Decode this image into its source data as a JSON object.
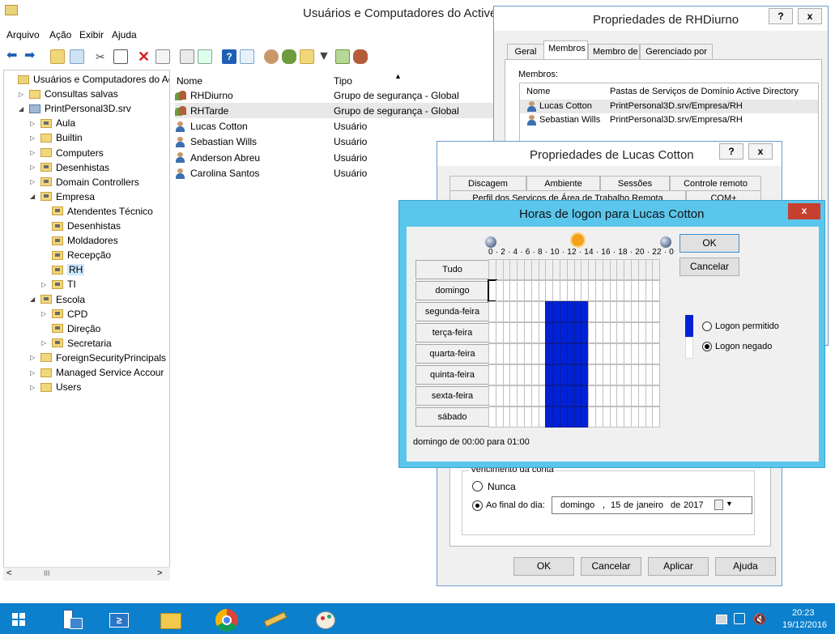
{
  "main": {
    "title": "Usuários e Computadores do Active",
    "menu": [
      "Arquivo",
      "Ação",
      "Exibir",
      "Ajuda"
    ],
    "tree": [
      {
        "label": "Usuários e Computadores do Ac",
        "indent": 0,
        "arrow": "",
        "icon": "root"
      },
      {
        "label": "Consultas salvas",
        "indent": 1,
        "arrow": "▷",
        "icon": "folder"
      },
      {
        "label": "PrintPersonal3D.srv",
        "indent": 1,
        "arrow": "◢",
        "icon": "domain"
      },
      {
        "label": "Aula",
        "indent": 2,
        "arrow": "▷",
        "icon": "ou"
      },
      {
        "label": "Builtin",
        "indent": 2,
        "arrow": "▷",
        "icon": "folder"
      },
      {
        "label": "Computers",
        "indent": 2,
        "arrow": "▷",
        "icon": "folder"
      },
      {
        "label": "Desenhistas",
        "indent": 2,
        "arrow": "▷",
        "icon": "ou"
      },
      {
        "label": "Domain Controllers",
        "indent": 2,
        "arrow": "▷",
        "icon": "ou"
      },
      {
        "label": "Empresa",
        "indent": 2,
        "arrow": "◢",
        "icon": "ou"
      },
      {
        "label": "Atendentes Técnico",
        "indent": 3,
        "arrow": "",
        "icon": "ou"
      },
      {
        "label": "Desenhistas",
        "indent": 3,
        "arrow": "",
        "icon": "ou"
      },
      {
        "label": "Moldadores",
        "indent": 3,
        "arrow": "",
        "icon": "ou"
      },
      {
        "label": "Recepção",
        "indent": 3,
        "arrow": "",
        "icon": "ou"
      },
      {
        "label": "RH",
        "indent": 3,
        "arrow": "",
        "icon": "ou"
      },
      {
        "label": "TI",
        "indent": 3,
        "arrow": "▷",
        "icon": "ou"
      },
      {
        "label": "Escola",
        "indent": 2,
        "arrow": "◢",
        "icon": "ou"
      },
      {
        "label": "CPD",
        "indent": 3,
        "arrow": "▷",
        "icon": "ou"
      },
      {
        "label": "Direção",
        "indent": 3,
        "arrow": "",
        "icon": "ou"
      },
      {
        "label": "Secretaria",
        "indent": 3,
        "arrow": "▷",
        "icon": "ou"
      },
      {
        "label": "ForeignSecurityPrincipals",
        "indent": 2,
        "arrow": "▷",
        "icon": "folder"
      },
      {
        "label": "Managed Service Accour",
        "indent": 2,
        "arrow": "▷",
        "icon": "folder"
      },
      {
        "label": "Users",
        "indent": 2,
        "arrow": "▷",
        "icon": "folder"
      }
    ],
    "selected_tree": "RH",
    "scroll_mark": "III",
    "columns": {
      "name": "Nome",
      "type": "Tipo"
    },
    "rows": [
      {
        "name": "RHDiurno",
        "type": "Grupo de segurança - Global",
        "kind": "group"
      },
      {
        "name": "RHTarde",
        "type": "Grupo de segurança - Global",
        "kind": "group"
      },
      {
        "name": "Lucas Cotton",
        "type": "Usuário",
        "kind": "user"
      },
      {
        "name": "Sebastian Wills",
        "type": "Usuário",
        "kind": "user"
      },
      {
        "name": "Anderson Abreu",
        "type": "Usuário",
        "kind": "user"
      },
      {
        "name": "Carolina Santos",
        "type": "Usuário",
        "kind": "user"
      }
    ]
  },
  "rhdiurno": {
    "title": "Propriedades de RHDiurno",
    "help": "?",
    "close": "x",
    "tabs": [
      "Geral",
      "Membros",
      "Membro de",
      "Gerenciado por"
    ],
    "members_label": "Membros:",
    "columns": {
      "name": "Nome",
      "folder": "Pastas de Serviços de Domínio Active Directory"
    },
    "members": [
      {
        "name": "Lucas Cotton",
        "folder": "PrintPersonal3D.srv/Empresa/RH"
      },
      {
        "name": "Sebastian Wills",
        "folder": "PrintPersonal3D.srv/Empresa/RH"
      }
    ]
  },
  "lucas": {
    "title": "Propriedades de Lucas Cotton",
    "help": "?",
    "close": "x",
    "tabs_row1": [
      "Discagem",
      "Ambiente",
      "Sessões",
      "Controle remoto"
    ],
    "tabs_row2": [
      "Perfil dos Serviços de Área de Trabalho Remota",
      "COM+"
    ],
    "expiry_label": "Vencimento da conta",
    "never": "Nunca",
    "end_of_day": "Ao final do dia:",
    "date": {
      "weekday": "domingo",
      "sep": ",",
      "day": "15",
      "de1": "de",
      "month": "janeiro",
      "de2": "de",
      "year": "2017"
    },
    "buttons": {
      "ok": "OK",
      "cancel": "Cancelar",
      "apply": "Aplicar",
      "help": "Ajuda"
    }
  },
  "logon": {
    "title": "Horas de logon para Lucas Cotton",
    "close": "x",
    "hours_scale": "0 · 2 · 4 · 6 · 8 · 10 · 12 · 14 · 16 · 18 · 20 · 22 · 0",
    "all": "Tudo",
    "days": [
      "domingo",
      "segunda-feira",
      "terça-feira",
      "quarta-feira",
      "quinta-feira",
      "sexta-feira",
      "sábado"
    ],
    "permitted_hours": [
      8,
      9,
      10,
      11,
      12,
      13
    ],
    "permitted_days": [
      1,
      2,
      3,
      4,
      5,
      6
    ],
    "ok": "OK",
    "cancel": "Cancelar",
    "legend_permitted": "Logon permitido",
    "legend_denied": "Logon negado",
    "status": "domingo de 00:00 para 01:00",
    "permitted_color": "#0022d6"
  },
  "taskbar": {
    "time": "20:23",
    "date": "19/12/2016",
    "accent": "#0c80cc"
  }
}
